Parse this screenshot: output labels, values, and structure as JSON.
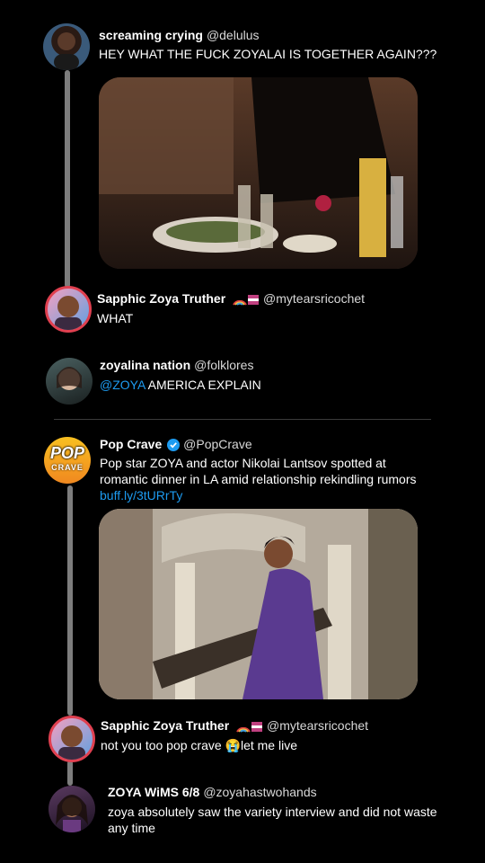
{
  "tweets": [
    {
      "display_name": "screaming crying",
      "handle": "@delulus",
      "text": "HEY WHAT THE FUCK ZOYALAI IS TOGETHER AGAIN???"
    },
    {
      "display_name": "Sapphic Zoya Truther",
      "handle": "@mytearsricochet",
      "text": "WHAT"
    },
    {
      "display_name": "zoyalina nation",
      "handle": "@folklores",
      "mention": "@ZOYA",
      "text": "AMERICA EXPLAIN"
    },
    {
      "display_name": "Pop Crave",
      "handle": "@PopCrave",
      "text": "Pop star ZOYA and actor Nikolai Lantsov spotted at romantic dinner in LA amid relationship rekindling rumors",
      "link": "buff.ly/3tURrTy",
      "logo_top": "POP",
      "logo_bottom": "CRAVE"
    },
    {
      "display_name": "Sapphic Zoya Truther",
      "handle": "@mytearsricochet",
      "text": "not you too pop crave 😭let me live"
    },
    {
      "display_name": "ZOYA WiMS 6/8",
      "handle": "@zoyahastwohands",
      "text": "zoya absolutely saw the variety interview and did not waste any time"
    }
  ],
  "colors": {
    "accent": "#1d9bf0",
    "thread": "#7d7d7d",
    "verified": "#1d9bf0"
  }
}
